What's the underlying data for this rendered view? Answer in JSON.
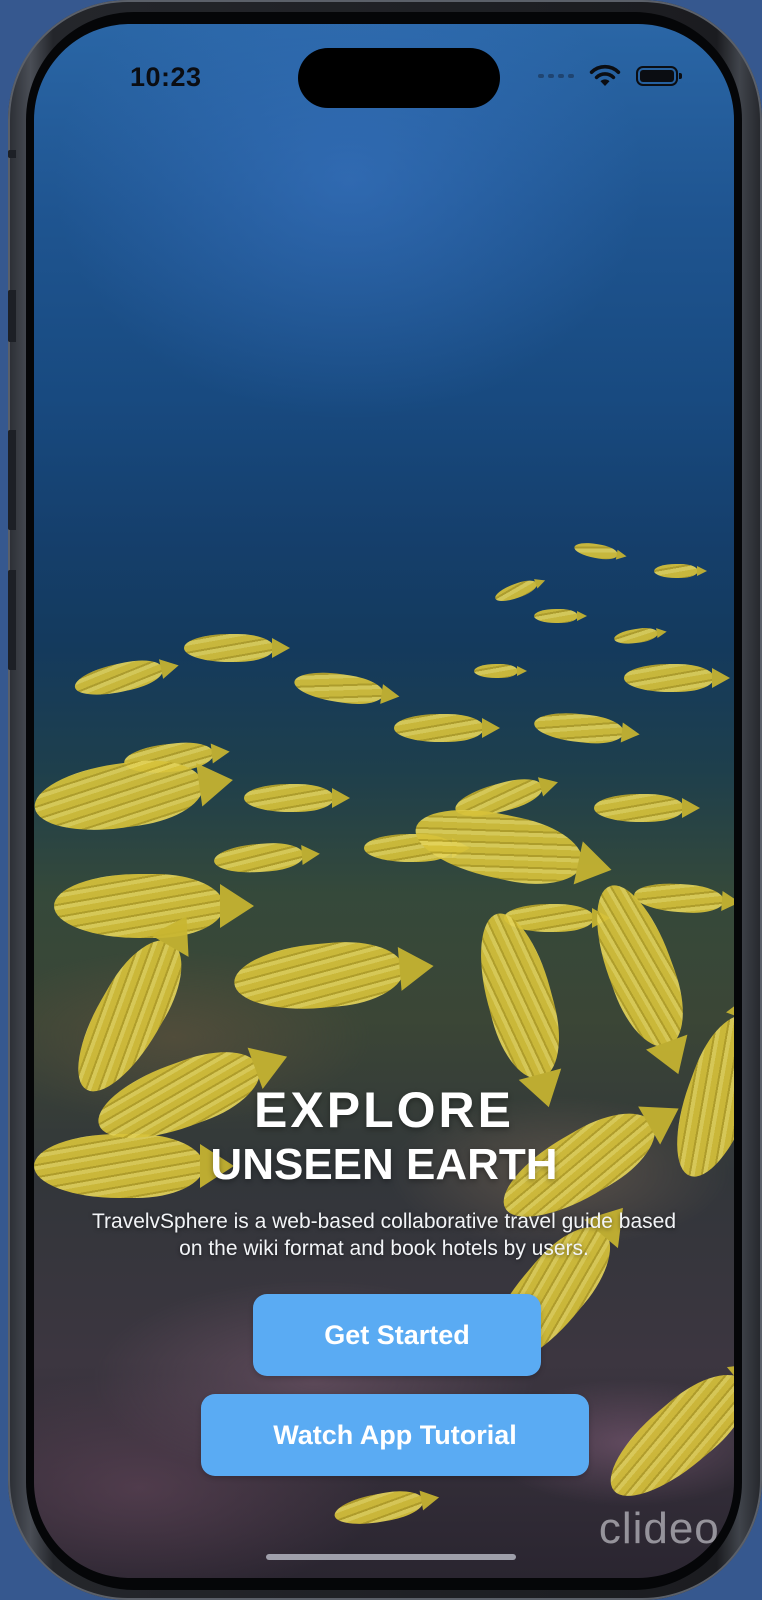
{
  "status_bar": {
    "time": "10:23",
    "icons": [
      "cellular-icon",
      "wifi-icon",
      "battery-icon"
    ]
  },
  "hero": {
    "title_line1": "EXPLORE",
    "title_line2": "UNSEEN EARTH",
    "description": "TravelvSphere is a web-based collaborative travel guide based on the wiki format and book hotels by users."
  },
  "buttons": {
    "get_started": "Get Started",
    "watch_tutorial": "Watch App Tutorial"
  },
  "watermark": "clideo.c",
  "colors": {
    "button_bg": "#5aabf3",
    "button_text": "#ffffff",
    "title_text": "#ffffff",
    "status_text": "#0b0d12"
  }
}
